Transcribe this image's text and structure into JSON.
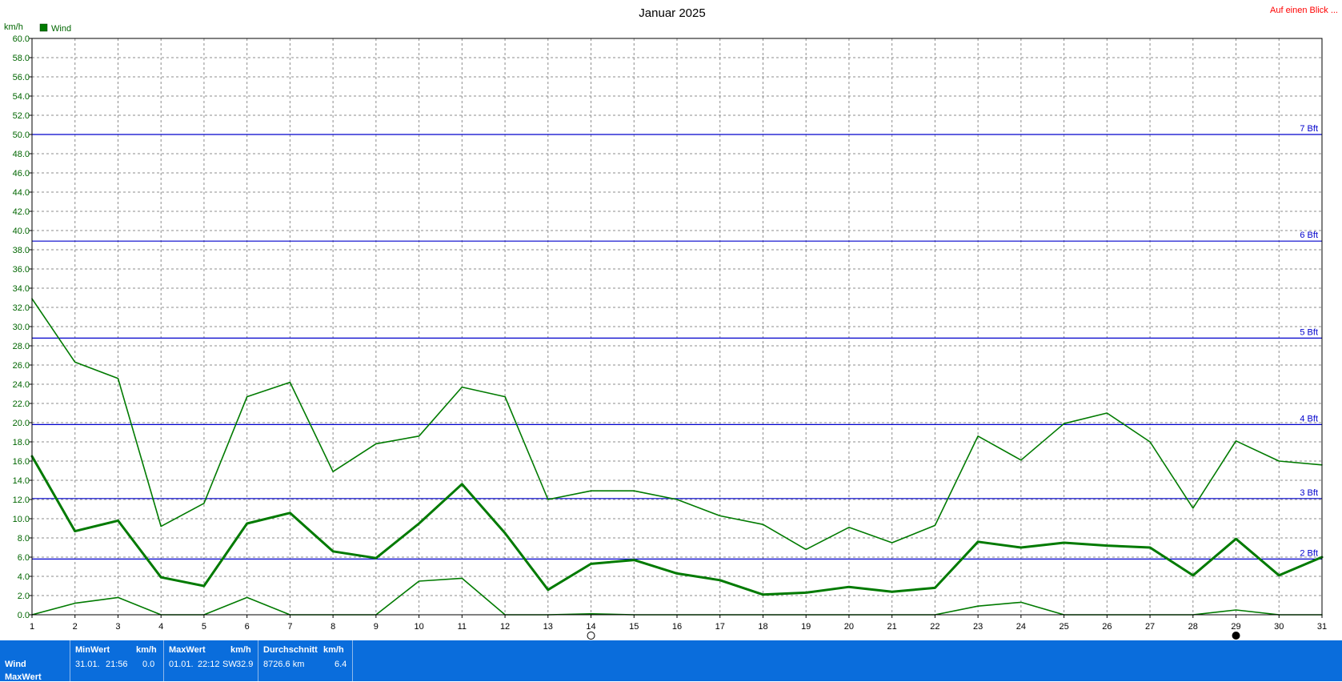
{
  "header": {
    "title": "Januar 2025",
    "link_label": "Auf einen Blick ..."
  },
  "chart_data": {
    "type": "line",
    "title": "Januar 2025",
    "ylabel": "km/h",
    "xlabel": "",
    "ylim": [
      0,
      60
    ],
    "xlim": [
      1,
      31
    ],
    "y_ticks": [
      "0.0",
      "2.0",
      "4.0",
      "6.0",
      "8.0",
      "10.0",
      "12.0",
      "14.0",
      "16.0",
      "18.0",
      "20.0",
      "22.0",
      "24.0",
      "26.0",
      "28.0",
      "30.0",
      "32.0",
      "34.0",
      "36.0",
      "38.0",
      "40.0",
      "42.0",
      "44.0",
      "46.0",
      "48.0",
      "50.0",
      "52.0",
      "54.0",
      "56.0",
      "58.0",
      "60.0"
    ],
    "x_ticks": [
      "1",
      "2",
      "3",
      "4",
      "5",
      "6",
      "7",
      "8",
      "9",
      "10",
      "11",
      "12",
      "13",
      "14",
      "15",
      "16",
      "17",
      "18",
      "19",
      "20",
      "21",
      "22",
      "23",
      "24",
      "25",
      "26",
      "27",
      "28",
      "29",
      "30",
      "31"
    ],
    "grid": true,
    "legend": {
      "position": "top-left",
      "entries": [
        {
          "label": "Wind",
          "color": "#007a00"
        }
      ]
    },
    "series_color": "#007a00",
    "series": [
      {
        "name": "Wind",
        "role": "max",
        "line_width": 1.6,
        "x": [
          1,
          2,
          3,
          4,
          5,
          6,
          7,
          8,
          9,
          10,
          11,
          12,
          13,
          14,
          15,
          16,
          17,
          18,
          19,
          20,
          21,
          22,
          23,
          24,
          25,
          26,
          27,
          28,
          29,
          30,
          31
        ],
        "values": [
          32.9,
          26.3,
          24.6,
          9.2,
          11.6,
          22.7,
          24.2,
          14.9,
          17.8,
          18.6,
          23.7,
          22.7,
          12.0,
          12.9,
          12.9,
          12.0,
          10.3,
          9.4,
          6.8,
          9.1,
          7.5,
          9.3,
          18.6,
          16.1,
          19.9,
          21.0,
          18.0,
          11.1,
          18.1,
          16.0,
          15.6
        ]
      },
      {
        "name": "Wind",
        "role": "mean",
        "line_width": 3,
        "x": [
          1,
          2,
          3,
          4,
          5,
          6,
          7,
          8,
          9,
          10,
          11,
          12,
          13,
          14,
          15,
          16,
          17,
          18,
          19,
          20,
          21,
          22,
          23,
          24,
          25,
          26,
          27,
          28,
          29,
          30,
          31
        ],
        "values": [
          16.5,
          8.7,
          9.8,
          3.9,
          3.0,
          9.5,
          10.6,
          6.6,
          5.9,
          9.5,
          13.6,
          8.5,
          2.6,
          5.3,
          5.7,
          4.3,
          3.6,
          2.1,
          2.3,
          2.9,
          2.4,
          2.8,
          7.6,
          7.0,
          7.5,
          7.2,
          7.0,
          4.1,
          7.9,
          4.1,
          6.0
        ]
      },
      {
        "name": "Wind",
        "role": "min",
        "line_width": 1.6,
        "x": [
          1,
          2,
          3,
          4,
          5,
          6,
          7,
          8,
          9,
          10,
          11,
          12,
          13,
          14,
          15,
          16,
          17,
          18,
          19,
          20,
          21,
          22,
          23,
          24,
          25,
          26,
          27,
          28,
          29,
          30,
          31
        ],
        "values": [
          0.0,
          1.2,
          1.8,
          0.0,
          0.0,
          1.8,
          0.0,
          0.0,
          0.0,
          3.5,
          3.8,
          0.0,
          0.0,
          0.1,
          0.0,
          0.0,
          0.0,
          0.0,
          0.0,
          0.0,
          0.0,
          0.0,
          0.9,
          1.3,
          0.0,
          0.0,
          0.0,
          0.0,
          0.5,
          0.0,
          0.0
        ]
      }
    ],
    "reference_lines": [
      {
        "label": "2 Bft",
        "value": 5.8
      },
      {
        "label": "3 Bft",
        "value": 12.1
      },
      {
        "label": "4 Bft",
        "value": 19.8
      },
      {
        "label": "5 Bft",
        "value": 28.8
      },
      {
        "label": "6 Bft",
        "value": 38.9
      },
      {
        "label": "7 Bft",
        "value": 50.0
      }
    ],
    "reference_color": "#0000cc",
    "moon_phases": [
      {
        "x": 14,
        "phase": "full"
      },
      {
        "x": 29,
        "phase": "new"
      }
    ]
  },
  "stats": {
    "row_labels": [
      "Wind",
      "MaxWert"
    ],
    "min": {
      "header": "MinWert",
      "unit": "km/h",
      "date": "31.01.",
      "time": "21:56",
      "value": "0.0"
    },
    "max": {
      "header": "MaxWert",
      "unit": "km/h",
      "date": "01.01.",
      "time": "22:12",
      "direction": "SW",
      "value": "32.9"
    },
    "avg": {
      "header": "Durchschnitt",
      "unit": "km/h",
      "distance": "8726.6 km",
      "value": "6.4"
    }
  }
}
